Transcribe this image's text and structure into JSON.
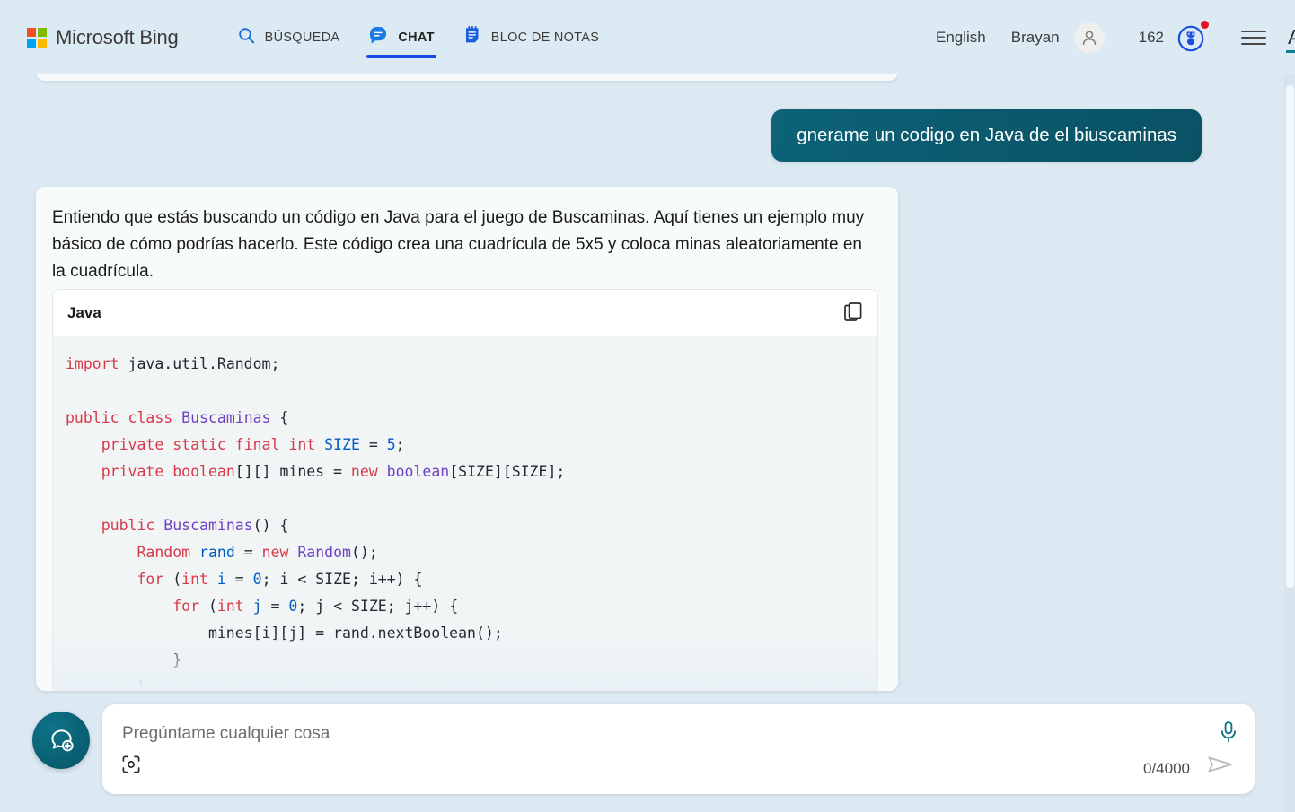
{
  "header": {
    "brand": "Microsoft Bing",
    "logo_icon": "microsoft-logo-icon",
    "nav": [
      {
        "label": "BÚSQUEDA",
        "icon": "search-icon",
        "active": false
      },
      {
        "label": "CHAT",
        "icon": "chat-bubble-icon",
        "active": true
      },
      {
        "label": "BLOC DE NOTAS",
        "icon": "notepad-icon",
        "active": false
      }
    ],
    "language": "English",
    "user_name": "Brayan",
    "avatar_icon": "person-avatar-icon",
    "rewards_points": "162",
    "rewards_icon": "rewards-medal-icon",
    "notification_dot": true,
    "menu_icon": "hamburger-menu-icon",
    "cut_off_letter": "A"
  },
  "conversation": {
    "user_message": "gnerame un codigo en Java de el biuscaminas",
    "assistant_message": "Entiendo que estás buscando un código en Java para el juego de Buscaminas. Aquí tienes un ejemplo muy básico de cómo podrías hacerlo. Este código crea una cuadrícula de 5x5 y coloca minas aleatoriamente en la cuadrícula.",
    "code_block": {
      "language_label": "Java",
      "copy_icon": "copy-icon",
      "lines": [
        [
          {
            "t": "import",
            "c": "k"
          },
          {
            "t": " java.util.Random;",
            "c": "p"
          }
        ],
        [],
        [
          {
            "t": "public",
            "c": "k"
          },
          {
            "t": " ",
            "c": "p"
          },
          {
            "t": "class",
            "c": "k"
          },
          {
            "t": " ",
            "c": "p"
          },
          {
            "t": "Buscaminas",
            "c": "t"
          },
          {
            "t": " {",
            "c": "p"
          }
        ],
        [
          {
            "t": "    ",
            "c": "p"
          },
          {
            "t": "private",
            "c": "k"
          },
          {
            "t": " ",
            "c": "p"
          },
          {
            "t": "static",
            "c": "k"
          },
          {
            "t": " ",
            "c": "p"
          },
          {
            "t": "final",
            "c": "k"
          },
          {
            "t": " ",
            "c": "p"
          },
          {
            "t": "int",
            "c": "k"
          },
          {
            "t": " ",
            "c": "p"
          },
          {
            "t": "SIZE",
            "c": "n"
          },
          {
            "t": " = ",
            "c": "p"
          },
          {
            "t": "5",
            "c": "n"
          },
          {
            "t": ";",
            "c": "p"
          }
        ],
        [
          {
            "t": "    ",
            "c": "p"
          },
          {
            "t": "private",
            "c": "k"
          },
          {
            "t": " ",
            "c": "p"
          },
          {
            "t": "boolean",
            "c": "k"
          },
          {
            "t": "[][] mines = ",
            "c": "p"
          },
          {
            "t": "new",
            "c": "k"
          },
          {
            "t": " ",
            "c": "p"
          },
          {
            "t": "boolean",
            "c": "t"
          },
          {
            "t": "[SIZE][SIZE];",
            "c": "p"
          }
        ],
        [],
        [
          {
            "t": "    ",
            "c": "p"
          },
          {
            "t": "public",
            "c": "k"
          },
          {
            "t": " ",
            "c": "p"
          },
          {
            "t": "Buscaminas",
            "c": "t"
          },
          {
            "t": "() {",
            "c": "p"
          }
        ],
        [
          {
            "t": "        ",
            "c": "p"
          },
          {
            "t": "Random",
            "c": "k"
          },
          {
            "t": " ",
            "c": "p"
          },
          {
            "t": "rand",
            "c": "n"
          },
          {
            "t": " = ",
            "c": "p"
          },
          {
            "t": "new",
            "c": "k"
          },
          {
            "t": " ",
            "c": "p"
          },
          {
            "t": "Random",
            "c": "t"
          },
          {
            "t": "();",
            "c": "p"
          }
        ],
        [
          {
            "t": "        ",
            "c": "p"
          },
          {
            "t": "for",
            "c": "k"
          },
          {
            "t": " (",
            "c": "p"
          },
          {
            "t": "int",
            "c": "k"
          },
          {
            "t": " ",
            "c": "p"
          },
          {
            "t": "i",
            "c": "n"
          },
          {
            "t": " = ",
            "c": "p"
          },
          {
            "t": "0",
            "c": "n"
          },
          {
            "t": "; i < SIZE; i++) {",
            "c": "p"
          }
        ],
        [
          {
            "t": "            ",
            "c": "p"
          },
          {
            "t": "for",
            "c": "k"
          },
          {
            "t": " (",
            "c": "p"
          },
          {
            "t": "int",
            "c": "k"
          },
          {
            "t": " ",
            "c": "p"
          },
          {
            "t": "j",
            "c": "n"
          },
          {
            "t": " = ",
            "c": "p"
          },
          {
            "t": "0",
            "c": "n"
          },
          {
            "t": "; j < SIZE; j++) {",
            "c": "p"
          }
        ],
        [
          {
            "t": "                mines[i][j] = rand.nextBoolean();",
            "c": "p"
          }
        ],
        [
          {
            "t": "            }",
            "c": "p"
          }
        ],
        [
          {
            "t": "        }",
            "c": "p"
          }
        ]
      ]
    }
  },
  "composer": {
    "new_chat_icon": "new-chat-bubble-plus-icon",
    "placeholder": "Pregúntame cualquier cosa",
    "value": "",
    "camera_icon": "visual-search-camera-icon",
    "mic_icon": "microphone-icon",
    "char_count": "0/4000",
    "send_icon": "send-paper-plane-icon"
  },
  "colors": {
    "page_background": "#dce9f2",
    "card_background": "#f8fbfb",
    "user_bubble": "#0c6277",
    "accent_teal": "#0b7f93",
    "nav_active_underline": "#174ae0",
    "notification_red": "#e81123",
    "code_keyword": "#d73a49",
    "code_type": "#6f42c1",
    "code_number": "#005cc5"
  }
}
